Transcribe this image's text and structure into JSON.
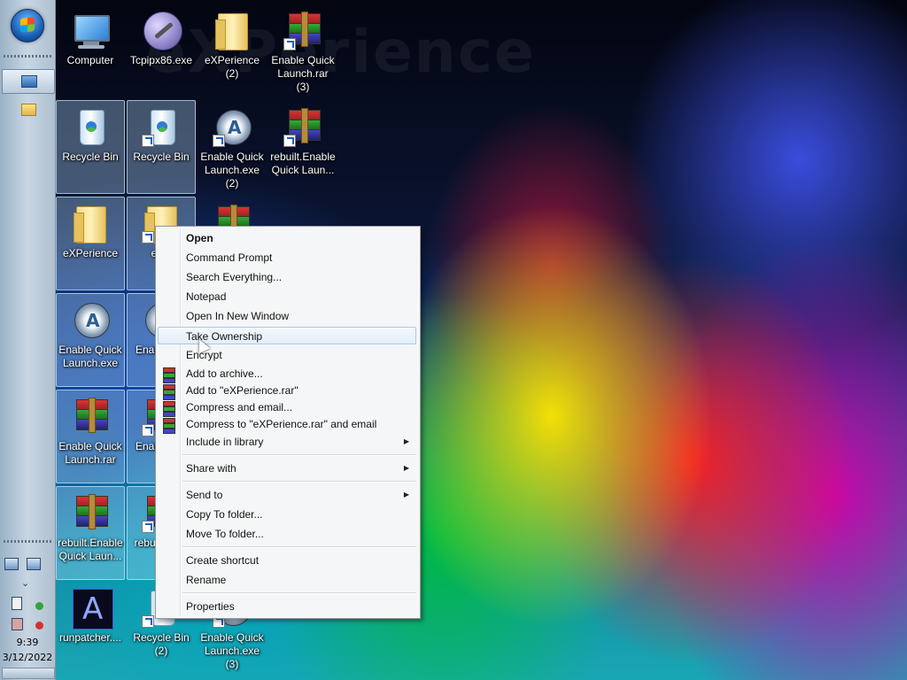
{
  "watermark": "eXPerience",
  "taskbar": {
    "clock_time": "9:39",
    "clock_date": "3/12/2022"
  },
  "desktop_icons": [
    {
      "label": "Computer",
      "icon": "computer-icon"
    },
    {
      "label": "Tcpipx86.exe",
      "icon": "network-globe-icon"
    },
    {
      "label": "eXPerience (2)",
      "icon": "folder-icon"
    },
    {
      "label": "Enable Quick Launch.rar (3)",
      "icon": "winrar-archive-icon"
    },
    {
      "label": "Recycle Bin",
      "icon": "recycle-bin-icon"
    },
    {
      "label": "Recycle Bin",
      "icon": "recycle-bin-icon"
    },
    {
      "label": "Enable Quick Launch.exe (2)",
      "icon": "autoit-icon"
    },
    {
      "label": "rebuilt.Enable Quick Laun...",
      "icon": "winrar-archive-icon"
    },
    {
      "label": "eXPerience",
      "icon": "folder-icon"
    },
    {
      "label": "eXP",
      "icon": "folder-icon"
    },
    {
      "label": "Enable Quick Launch.exe",
      "icon": "autoit-icon"
    },
    {
      "label": "Enab Laun",
      "icon": "autoit-icon"
    },
    {
      "label": "Enable Quick Launch.rar",
      "icon": "winrar-archive-icon"
    },
    {
      "label": "Enab Laun",
      "icon": "winrar-archive-icon"
    },
    {
      "label": "rebuilt.Enable Quick Laun...",
      "icon": "winrar-archive-icon"
    },
    {
      "label": "rebui Quick",
      "icon": "winrar-archive-icon"
    },
    {
      "label": "runpatcher....",
      "icon": "runpatcher-icon"
    },
    {
      "label": "Recycle Bin (2)",
      "icon": "recycle-bin-icon"
    },
    {
      "label": "Enable Quick Launch.exe (3)",
      "icon": "autoit-icon"
    }
  ],
  "context_menu": {
    "items": [
      {
        "label": "Open"
      },
      {
        "label": "Command Prompt"
      },
      {
        "label": "Search Everything..."
      },
      {
        "label": "Notepad"
      },
      {
        "label": "Open In New Window"
      },
      {
        "label": "Take Ownership"
      },
      {
        "label": "Encrypt"
      },
      {
        "label": "Add to archive..."
      },
      {
        "label": "Add to \"eXPerience.rar\""
      },
      {
        "label": "Compress and email..."
      },
      {
        "label": "Compress to \"eXPerience.rar\" and email"
      },
      {
        "label": "Include in library"
      },
      {
        "label": "Share with"
      },
      {
        "label": "Send to"
      },
      {
        "label": "Copy To folder..."
      },
      {
        "label": "Move To folder..."
      },
      {
        "label": "Create shortcut"
      },
      {
        "label": "Rename"
      },
      {
        "label": "Properties"
      }
    ],
    "submenu_glyph": "▶"
  }
}
